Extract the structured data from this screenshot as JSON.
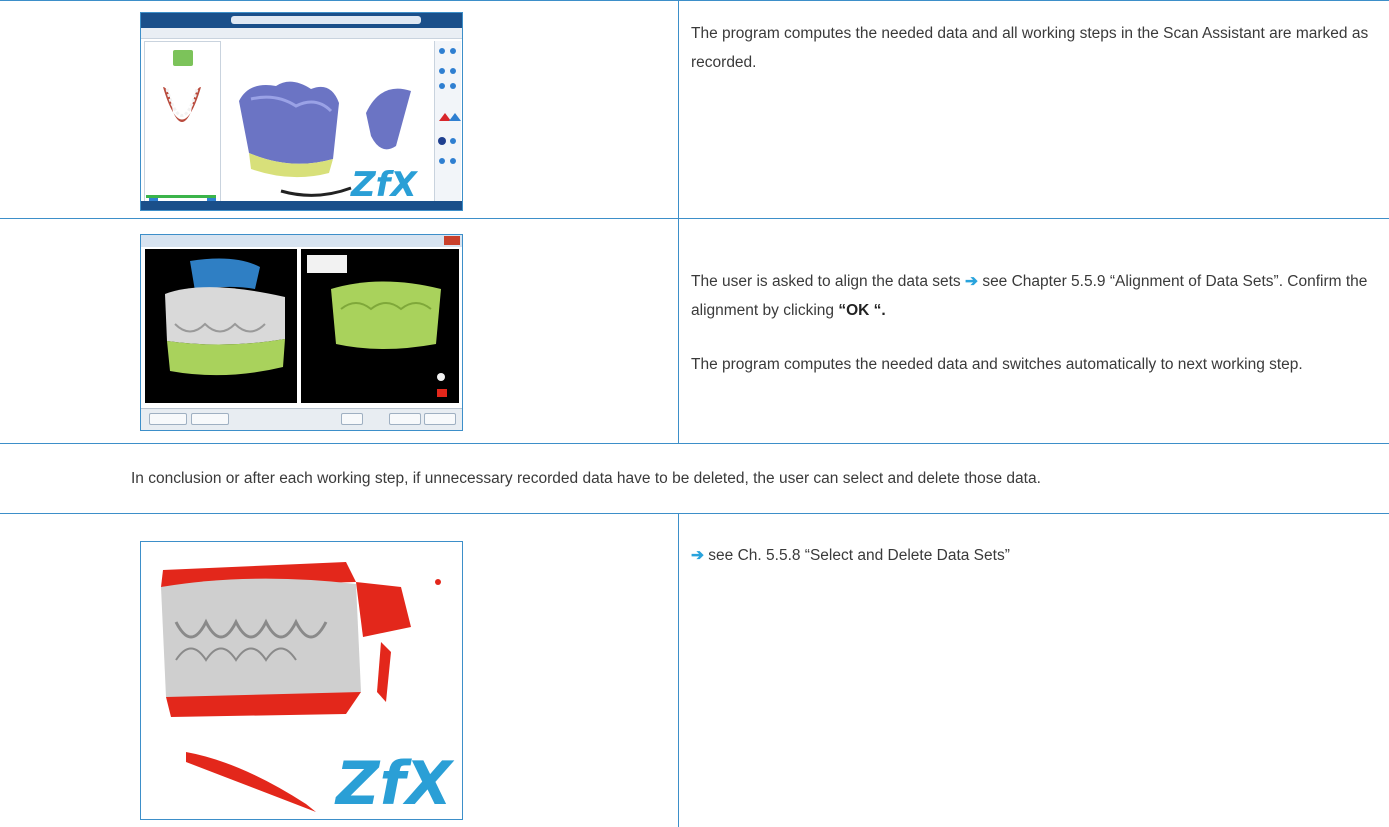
{
  "rows": [
    {
      "text": "The program computes the needed data and all working steps in the Scan Assistant are marked as recorded."
    },
    {
      "paragraph1": {
        "before": "The user is asked to align the data sets",
        "arrow": "➔",
        "after": " see Chapter 5.5.9 “Alignment of Data Sets”. Confirm the alignment by clicking ",
        "bold": "“OK “."
      },
      "paragraph2": "The program computes the needed data and switches automatically to next working step."
    }
  ],
  "conclusion": "In conclusion or after each working step, if unnecessary recorded data have to be deleted, the user can select and delete those data.",
  "row3": {
    "arrow": "➔",
    "text": " see Ch. 5.5.8 “Select and Delete Data Sets”"
  },
  "colors": {
    "rule": "#3d8fc9",
    "arrow": "#29a3dc",
    "logo": "#2a9fd6",
    "model_blue": "#6b74c4",
    "model_green": "#a9d25c",
    "model_red": "#e3271b"
  }
}
